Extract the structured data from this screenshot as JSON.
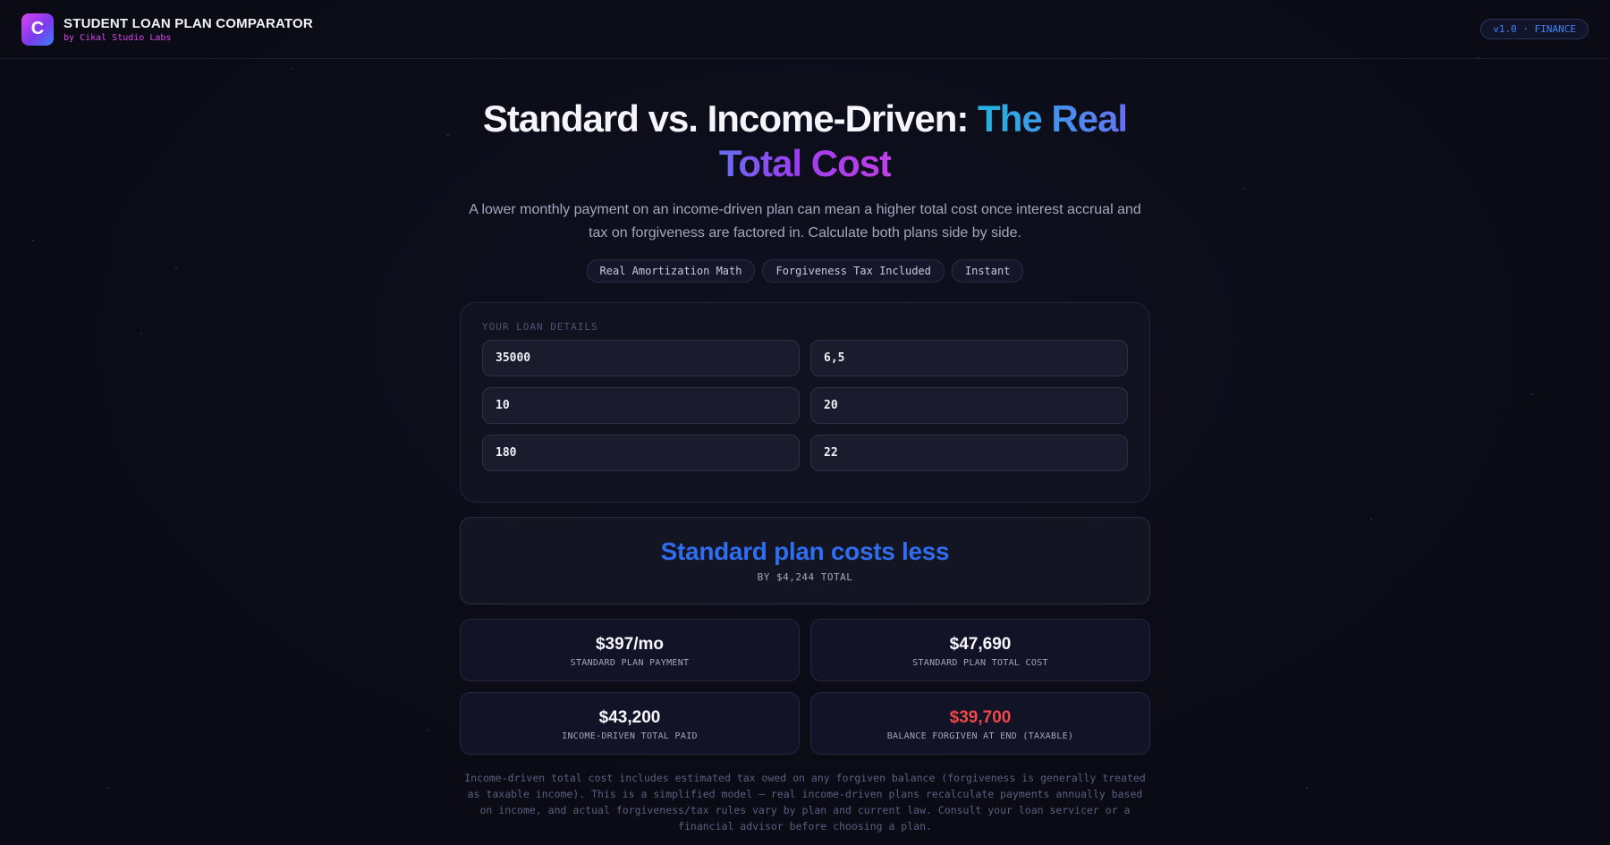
{
  "app": {
    "logo_letter": "C",
    "title": "STUDENT LOAN PLAN COMPARATOR",
    "subtitle": "by Cikal Studio Labs",
    "version": "v1.0 · FINANCE"
  },
  "hero": {
    "title_plain": "Standard vs. Income-Driven: ",
    "title_highlight": "The Real Total Cost",
    "description": "A lower monthly payment on an income-driven plan can mean a higher total cost once interest accrual and tax on forgiveness are factored in. Calculate both plans side by side.",
    "chips": [
      "Real Amortization Math",
      "Forgiveness Tax Included",
      "Instant"
    ]
  },
  "loan_details": {
    "label": "YOUR LOAN DETAILS",
    "fields": [
      "35000",
      "6,5",
      "10",
      "20",
      "180",
      "22"
    ]
  },
  "verdict": {
    "title": "Standard plan costs less",
    "subtitle": "BY $4,244 TOTAL"
  },
  "stats": [
    {
      "value": "$397/mo",
      "label": "STANDARD PLAN PAYMENT"
    },
    {
      "value": "$47,690",
      "label": "STANDARD PLAN TOTAL COST"
    },
    {
      "value": "$43,200",
      "label": "INCOME-DRIVEN TOTAL PAID"
    },
    {
      "value": "$39,700",
      "label": "BALANCE FORGIVEN AT END (TAXABLE)"
    }
  ],
  "colors": {
    "accent_blue": "#2f6ef0",
    "alert_red": "#f04848",
    "brand_magenta": "#d946ef"
  },
  "disclaimer": "Income-driven total cost includes estimated tax owed on any forgiven balance (forgiveness is generally treated as taxable income). This is a simplified model — real income-driven plans recalculate payments annually based on income, and actual forgiveness/tax rules vary by plan and current law. Consult your loan servicer or a financial advisor before choosing a plan."
}
